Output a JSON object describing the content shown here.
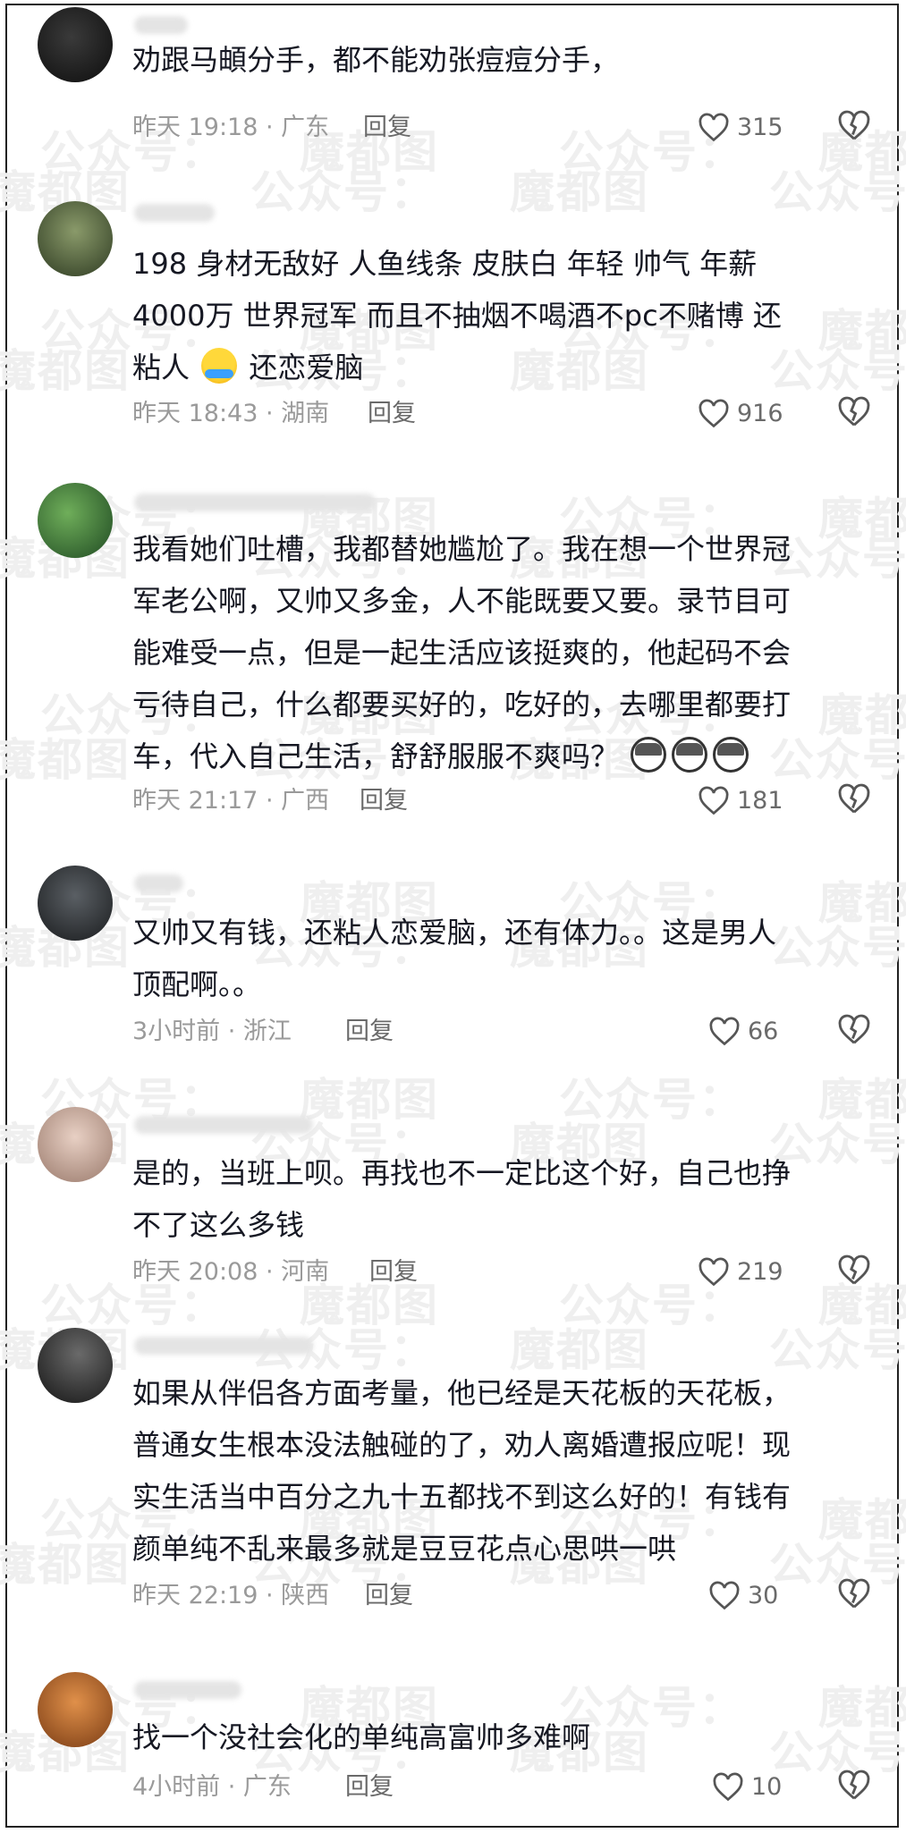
{
  "watermark": {
    "text_a": "魔都图",
    "text_b": "公众号：",
    "text_c": "众号："
  },
  "comments": [
    {
      "text": "劝跟马頔分手，都不能劝张痘痘分手，",
      "time": "昨天 19:18 · 广东",
      "reply": "回复",
      "likes": "315",
      "avatar_color": "#1c1c1c"
    },
    {
      "text_1": "198 身材无敌好 人鱼线条 皮肤白 年轻 帅气 年薪",
      "text_2": "4000万 世界冠军  而且不抽烟不喝酒不pc不赌博 还",
      "text_3a": "粘人",
      "text_3b": "还恋爱脑",
      "time": "昨天 18:43 · 湖南",
      "reply": "回复",
      "likes": "916",
      "avatar_color": "#4a5d3a"
    },
    {
      "text_1": "我看她们吐槽，我都替她尴尬了。我在想一个世界冠",
      "text_2": "军老公啊，又帅又多金，人不能既要又要。录节目可",
      "text_3": "能难受一点，但是一起生活应该挺爽的，他起码不会",
      "text_4": "亏待自己，什么都要买好的，吃好的，去哪里都要打",
      "text_5": "车，代入自己生活，舒舒服服不爽吗？",
      "time": "昨天 21:17 · 广西",
      "reply": "回复",
      "likes": "181",
      "avatar_color": "#3f7a3a"
    },
    {
      "text_1": "又帅又有钱，还粘人恋爱脑，还有体力。。这是男人",
      "text_2": "顶配啊。。",
      "time": "3小时前 · 浙江",
      "reply": "回复",
      "likes": "66",
      "avatar_color": "#2e3236"
    },
    {
      "text_1": "是的，当班上呗。再找也不一定比这个好，自己也挣",
      "text_2": "不了这么多钱",
      "time": "昨天 20:08 · 河南",
      "reply": "回复",
      "likes": "219",
      "avatar_color": "#c9a896"
    },
    {
      "text_1": "如果从伴侣各方面考量，他已经是天花板的天花板，",
      "text_2": "普通女生根本没法触碰的了，劝人离婚遭报应呢！现",
      "text_3": "实生活当中百分之九十五都找不到这么好的！有钱有",
      "text_4": "颜单纯不乱来最多就是豆豆花点心思哄一哄",
      "time": "昨天 22:19 · 陕西",
      "reply": "回复",
      "likes": "30",
      "avatar_color": "#2b2b2b"
    },
    {
      "text": "找一个没社会化的单纯高富帅多难啊",
      "time": "4小时前 · 广东",
      "reply": "回复",
      "likes": "10",
      "avatar_color": "#c06a2a"
    }
  ]
}
